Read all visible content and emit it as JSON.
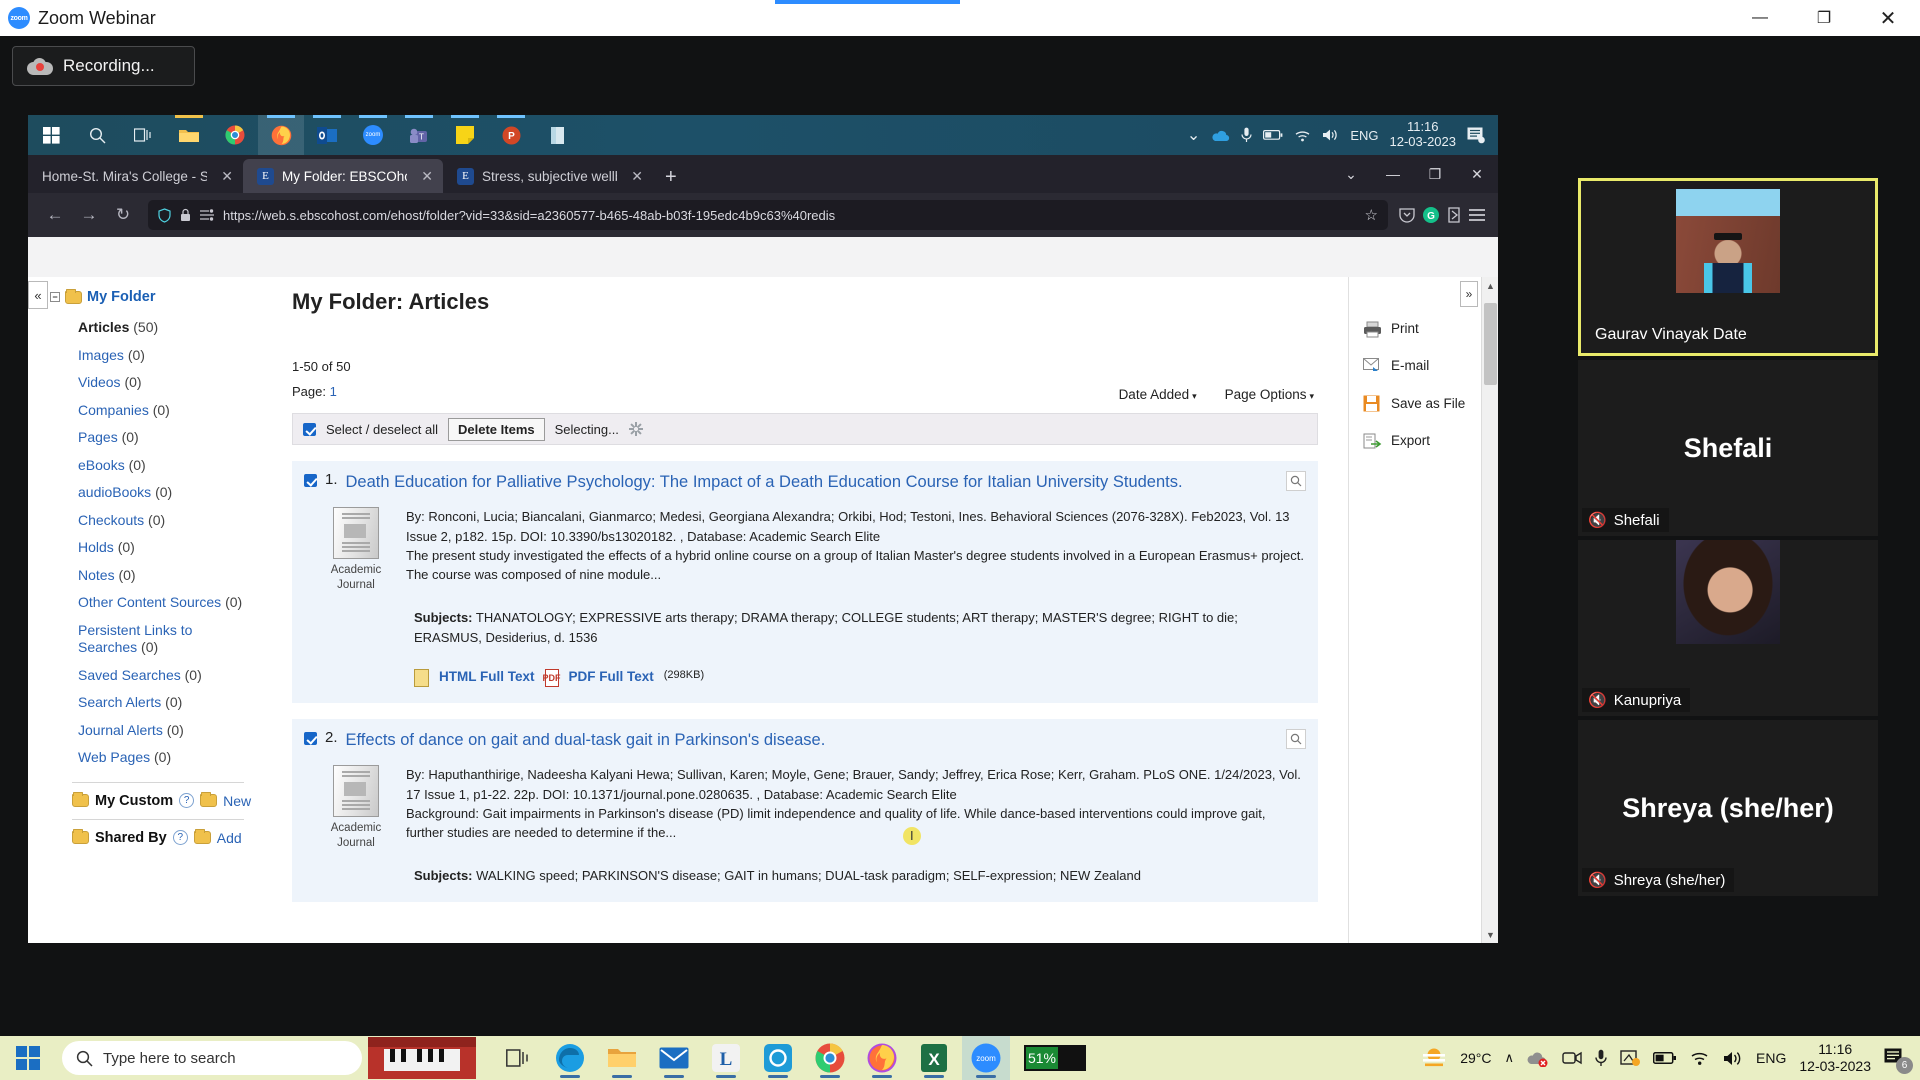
{
  "zoom_window": {
    "title": "Zoom Webinar",
    "logo_text": "zoom",
    "recording_label": "Recording...",
    "minimize": "—",
    "maximize": "❐",
    "close": "✕"
  },
  "inner_taskbar": {
    "icons": [
      "windows-start-icon",
      "search-icon",
      "task-view-icon",
      "file-explorer-icon",
      "chrome-icon",
      "firefox-icon",
      "outlook-icon",
      "zoom-icon",
      "teams-icon",
      "sticky-notes-icon",
      "powerpoint-icon",
      "onenote-icon"
    ],
    "tray": {
      "chevron": "⌄",
      "onedrive": "onedrive-icon",
      "mic": "mic-icon",
      "battery": "battery-icon",
      "wifi": "wifi-icon",
      "volume": "volume-icon",
      "language": "ENG",
      "time": "11:16",
      "date": "12-03-2023",
      "notifications": "notifications-icon"
    }
  },
  "browser": {
    "tabs": [
      {
        "favicon": "",
        "label": "Home-St. Mira's College - ST M",
        "active": false
      },
      {
        "favicon": "E",
        "label": "My Folder: EBSCOhost",
        "active": true
      },
      {
        "favicon": "E",
        "label": "Stress, subjective wellbeing and",
        "active": false
      }
    ],
    "new_tab": "+",
    "list_all_tabs": "⌄",
    "window_buttons": {
      "minimize": "—",
      "maximize": "❐",
      "close": "✕"
    },
    "nav": {
      "back": "←",
      "forward": "→",
      "reload": "↻"
    },
    "url": "https://web.s.ebscohost.com/ehost/folder?vid=33&sid=a2360577-b465-48ab-b03f-195edc4b9c63%40redis",
    "url_host": "web.s.ebscohost.com",
    "bookmark_star": "☆",
    "right_icons": [
      "pocket-icon",
      "grammarly-icon",
      "extension-icon",
      "hamburger-menu-icon"
    ]
  },
  "sidebar": {
    "collapse_label": "«",
    "folder_title": "My Folder",
    "expander": "−",
    "items": [
      {
        "label": "Articles",
        "count": "(50)",
        "selected": true
      },
      {
        "label": "Images",
        "count": "(0)",
        "selected": false
      },
      {
        "label": "Videos",
        "count": "(0)",
        "selected": false
      },
      {
        "label": "Companies",
        "count": "(0)",
        "selected": false
      },
      {
        "label": "Pages",
        "count": "(0)",
        "selected": false
      },
      {
        "label": "eBooks",
        "count": "(0)",
        "selected": false
      },
      {
        "label": "audioBooks",
        "count": "(0)",
        "selected": false
      },
      {
        "label": "Checkouts",
        "count": "(0)",
        "selected": false
      },
      {
        "label": "Holds",
        "count": "(0)",
        "selected": false
      },
      {
        "label": "Notes",
        "count": "(0)",
        "selected": false
      },
      {
        "label": "Other Content Sources",
        "count": "(0)",
        "selected": false
      },
      {
        "label": "Persistent Links to Searches",
        "count": "(0)",
        "selected": false
      },
      {
        "label": "Saved Searches",
        "count": "(0)",
        "selected": false
      },
      {
        "label": "Search Alerts",
        "count": "(0)",
        "selected": false
      },
      {
        "label": "Journal Alerts",
        "count": "(0)",
        "selected": false
      },
      {
        "label": "Web Pages",
        "count": "(0)",
        "selected": false
      }
    ],
    "my_custom": {
      "label": "My Custom",
      "help": "?",
      "action": "New"
    },
    "shared_by": {
      "label": "Shared By",
      "help": "?",
      "action": "Add"
    }
  },
  "main": {
    "title": "My Folder: Articles",
    "result_count": "1-50 of 50",
    "page_label": "Page:",
    "page_number": "1",
    "sort": {
      "date_added": "Date Added",
      "page_options": "Page Options",
      "caret": "▾"
    },
    "toolbar": {
      "select_all": "Select / deselect all",
      "delete_items": "Delete Items",
      "selecting": "Selecting..."
    },
    "expand_label": "»",
    "articles": [
      {
        "number": "1.",
        "title": "Death Education for Palliative Psychology: The Impact of a Death Education Course for Italian University Students.",
        "type_caption_line1": "Academic",
        "type_caption_line2": "Journal",
        "citation": "By: Ronconi, Lucia; Biancalani, Gianmarco; Medesi, Georgiana Alexandra; Orkibi, Hod; Testoni, Ines. Behavioral Sciences (2076-328X). Feb2023, Vol. 13 Issue 2, p182. 15p. DOI: 10.3390/bs13020182. , Database: Academic Search Elite",
        "abstract": "The present study investigated the effects of a hybrid online course on a group of Italian Master's degree students involved in a European Erasmus+ project. The course was composed of nine module...",
        "subjects_label": "Subjects:",
        "subjects": "THANATOLOGY; EXPRESSIVE arts therapy; DRAMA therapy; COLLEGE students; ART therapy; MASTER'S degree; RIGHT to die; ERASMUS, Desiderius, d. 1536",
        "links": [
          {
            "label": "HTML Full Text",
            "size": ""
          },
          {
            "label": "PDF Full Text",
            "size": "(298KB)"
          }
        ]
      },
      {
        "number": "2.",
        "title": "Effects of dance on gait and dual-task gait in Parkinson's disease.",
        "type_caption_line1": "Academic",
        "type_caption_line2": "Journal",
        "citation": "By: Haputhanthirige, Nadeesha Kalyani Hewa; Sullivan, Karen; Moyle, Gene; Brauer, Sandy; Jeffrey, Erica Rose; Kerr, Graham. PLoS ONE. 1/24/2023, Vol. 17 Issue 1, p1-22. 22p. DOI: 10.1371/journal.pone.0280635. , Database: Academic Search Elite",
        "abstract": "Background: Gait impairments in Parkinson's disease (PD) limit independence and quality of life. While dance-based interventions could improve gait, further studies are needed to determine if the...",
        "subjects_label": "Subjects:",
        "subjects": "WALKING speed; PARKINSON'S disease; GAIT in humans; DUAL-task paradigm; SELF-expression; NEW Zealand",
        "links": []
      }
    ],
    "tools": [
      {
        "label": "Print",
        "icon": "printer-icon"
      },
      {
        "label": "E-mail",
        "icon": "envelope-icon"
      },
      {
        "label": "Save as File",
        "icon": "floppy-disk-icon"
      },
      {
        "label": "Export",
        "icon": "export-icon"
      }
    ]
  },
  "participants": [
    {
      "name": "Gaurav Vinayak Date",
      "active": true,
      "muted": false,
      "has_video": true,
      "avatar": "photo"
    },
    {
      "name": "Shefali",
      "active": false,
      "muted": true,
      "has_video": false,
      "avatar": "name"
    },
    {
      "name": "Kanupriya",
      "active": false,
      "muted": true,
      "has_video": true,
      "avatar": "photo"
    },
    {
      "name": "Shreya (she/her)",
      "active": false,
      "muted": true,
      "has_video": false,
      "avatar": "name"
    }
  ],
  "taskbar": {
    "start": "windows-start-icon",
    "search_placeholder": "Type here to search",
    "apps": [
      "task-view-icon",
      "edge-icon",
      "file-explorer-icon",
      "mail-icon",
      "l-app-icon",
      "teams-icon",
      "chrome-icon",
      "firefox-icon",
      "excel-icon",
      "zoom-icon"
    ],
    "battery_percent": "51%",
    "weather": "29°C",
    "tray": {
      "chevron": "∧",
      "language": "ENG",
      "time": "11:16",
      "date": "12-03-2023",
      "notification_count": "6"
    }
  }
}
